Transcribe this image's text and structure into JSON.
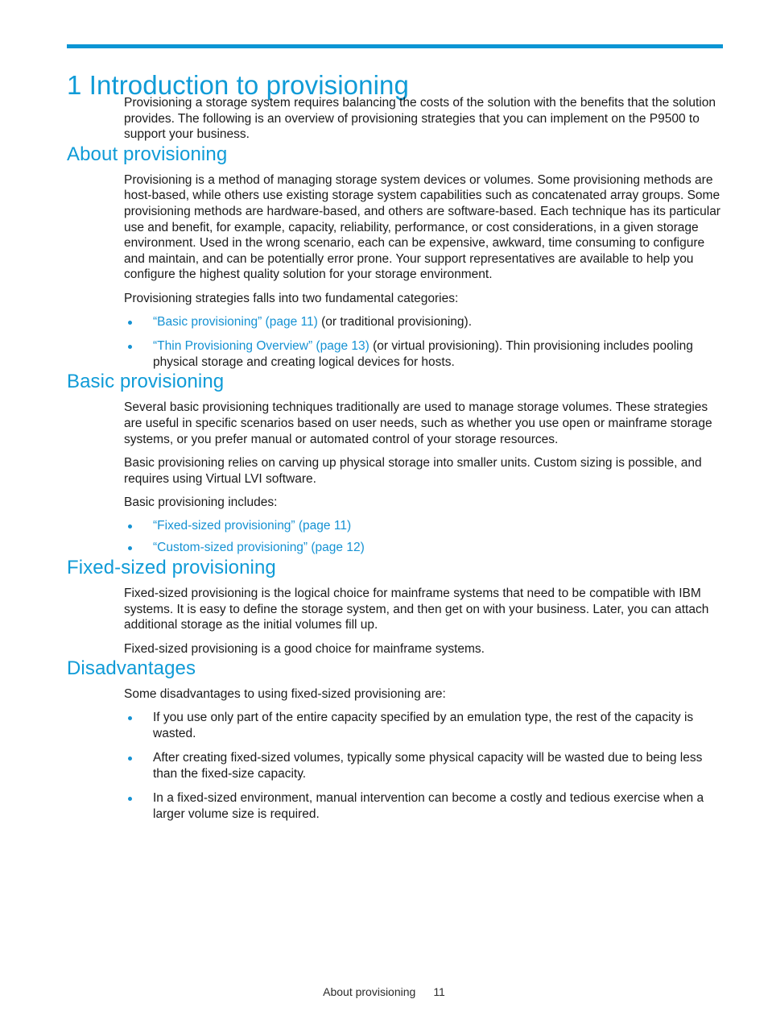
{
  "colors": {
    "accent": "#0f9bd7",
    "rule": "#0b95d4",
    "link": "#1592d3",
    "body_text": "#1a1a1a"
  },
  "chapter": {
    "rule": "",
    "title": "1 Introduction to provisioning"
  },
  "intro": {
    "paragraph": "Provisioning a storage system requires balancing the costs of the solution with the benefits that the solution provides. The following is an overview of provisioning strategies that you can implement on the P9500 to support your business."
  },
  "about_provisioning": {
    "heading": "About provisioning",
    "paragraph_1": "Provisioning is a method of managing storage system devices or volumes. Some provisioning methods are host-based, while others use existing storage system capabilities such as concatenated array groups. Some provisioning methods are hardware-based, and others are software-based. Each technique has its particular use and benefit, for example, capacity, reliability, performance, or cost considerations, in a given storage environment. Used in the wrong scenario, each can be expensive, awkward, time consuming to configure and maintain, and can be potentially error prone. Your support representatives are available to help you configure the highest quality solution for your storage environment.",
    "paragraph_2": "Provisioning strategies falls into two fundamental categories:",
    "bullets": [
      {
        "link": "“Basic provisioning” (page 11)",
        "rest": " (or traditional provisioning)."
      },
      {
        "link": "“Thin Provisioning Overview” (page 13)",
        "rest": " (or virtual provisioning). Thin provisioning includes pooling physical storage and creating logical devices for hosts."
      }
    ]
  },
  "basic_provisioning": {
    "heading": "Basic provisioning",
    "paragraph_1": "Several basic provisioning techniques traditionally are used to manage storage volumes. These strategies are useful in specific scenarios based on user needs, such as whether you use open or mainframe storage systems, or you prefer manual or automated control of your storage resources.",
    "paragraph_2": "Basic provisioning relies on carving up physical storage into smaller units. Custom sizing is possible, and requires using Virtual LVI software.",
    "paragraph_3": "Basic provisioning includes:",
    "bullets": [
      {
        "link": "“Fixed-sized provisioning” (page 11)",
        "rest": ""
      },
      {
        "link": "“Custom-sized provisioning” (page 12)",
        "rest": ""
      }
    ]
  },
  "fixed_sized_provisioning": {
    "heading": "Fixed-sized provisioning",
    "paragraph_1": "Fixed-sized provisioning is the logical choice for mainframe systems that need to be compatible with IBM systems. It is easy to define the storage system, and then get on with your business. Later, you can attach additional storage as the initial volumes fill up.",
    "paragraph_2": "Fixed-sized provisioning is a good choice for mainframe systems."
  },
  "disadvantages": {
    "heading": "Disadvantages",
    "paragraph_1": "Some disadvantages to using fixed-sized provisioning are:",
    "bullets": [
      "If you use only part of the entire capacity specified by an emulation type, the rest of the capacity is wasted.",
      "After creating fixed-sized volumes, typically some physical capacity will be wasted due to being less than the fixed-size capacity.",
      "In a fixed-sized environment, manual intervention can become a costly and tedious exercise when a larger volume size is required."
    ]
  },
  "footer": {
    "section_label": "About provisioning",
    "page_number": "11"
  }
}
